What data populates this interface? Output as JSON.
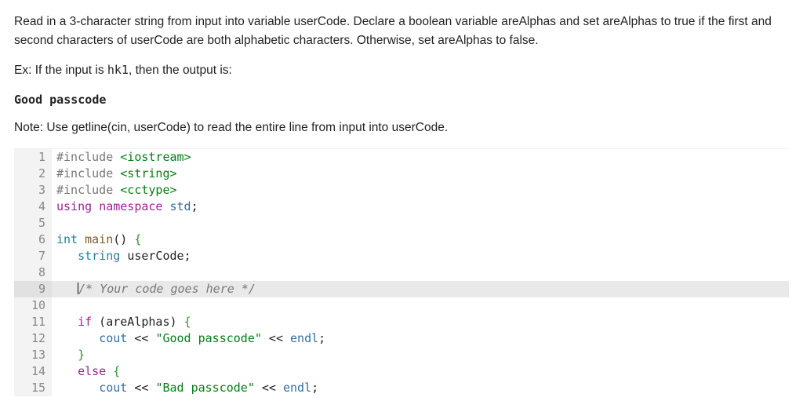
{
  "prompt": {
    "p1": "Read in a 3-character string from input into variable userCode. Declare a boolean variable areAlphas and set areAlphas to true if the first and second characters of userCode are both alphabetic characters. Otherwise, set areAlphas to false.",
    "p2_prefix": "Ex: If the input is ",
    "p2_mono": "hk1",
    "p2_suffix": ", then the output is:",
    "output_line": "Good passcode",
    "note": "Note: Use getline(cin, userCode) to read the entire line from input into userCode."
  },
  "code_lines": [
    {
      "n": 1,
      "tokens": [
        [
          "pp",
          "#include "
        ],
        [
          "hdr",
          "<iostream>"
        ]
      ]
    },
    {
      "n": 2,
      "tokens": [
        [
          "pp",
          "#include "
        ],
        [
          "hdr",
          "<string>"
        ]
      ]
    },
    {
      "n": 3,
      "tokens": [
        [
          "pp",
          "#include "
        ],
        [
          "hdr",
          "<cctype>"
        ]
      ]
    },
    {
      "n": 4,
      "tokens": [
        [
          "kw",
          "using"
        ],
        [
          "",
          " "
        ],
        [
          "kw",
          "namespace"
        ],
        [
          "",
          " "
        ],
        [
          "ns",
          "std"
        ],
        [
          "",
          ";"
        ]
      ]
    },
    {
      "n": 5,
      "tokens": []
    },
    {
      "n": 6,
      "tokens": [
        [
          "ty",
          "int"
        ],
        [
          "",
          " "
        ],
        [
          "fn",
          "main"
        ],
        [
          "",
          "() "
        ],
        [
          "br",
          "{"
        ]
      ]
    },
    {
      "n": 7,
      "tokens": [
        [
          "",
          "   "
        ],
        [
          "ty",
          "string"
        ],
        [
          "",
          " "
        ],
        [
          "",
          "userCode;"
        ]
      ]
    },
    {
      "n": 8,
      "tokens": []
    },
    {
      "n": 9,
      "hl": true,
      "cursor": true,
      "tokens": [
        [
          "",
          "   "
        ],
        [
          "cmnt",
          "/* Your code goes here */"
        ]
      ]
    },
    {
      "n": 10,
      "tokens": []
    },
    {
      "n": 11,
      "tokens": [
        [
          "",
          "   "
        ],
        [
          "kw",
          "if"
        ],
        [
          "",
          " ("
        ],
        [
          "",
          "areAlphas"
        ],
        [
          "",
          ") "
        ],
        [
          "br",
          "{"
        ]
      ]
    },
    {
      "n": 12,
      "tokens": [
        [
          "",
          "      "
        ],
        [
          "id2",
          "cout"
        ],
        [
          "",
          " << "
        ],
        [
          "str",
          "\"Good passcode\""
        ],
        [
          "",
          " << "
        ],
        [
          "id2",
          "endl"
        ],
        [
          "",
          ";"
        ]
      ]
    },
    {
      "n": 13,
      "tokens": [
        [
          "",
          "   "
        ],
        [
          "br",
          "}"
        ]
      ]
    },
    {
      "n": 14,
      "tokens": [
        [
          "",
          "   "
        ],
        [
          "kw",
          "else"
        ],
        [
          "",
          " "
        ],
        [
          "br",
          "{"
        ]
      ]
    },
    {
      "n": 15,
      "tokens": [
        [
          "",
          "      "
        ],
        [
          "id2",
          "cout"
        ],
        [
          "",
          " << "
        ],
        [
          "str",
          "\"Bad passcode\""
        ],
        [
          "",
          " << "
        ],
        [
          "id2",
          "endl"
        ],
        [
          "",
          ";"
        ]
      ]
    }
  ]
}
